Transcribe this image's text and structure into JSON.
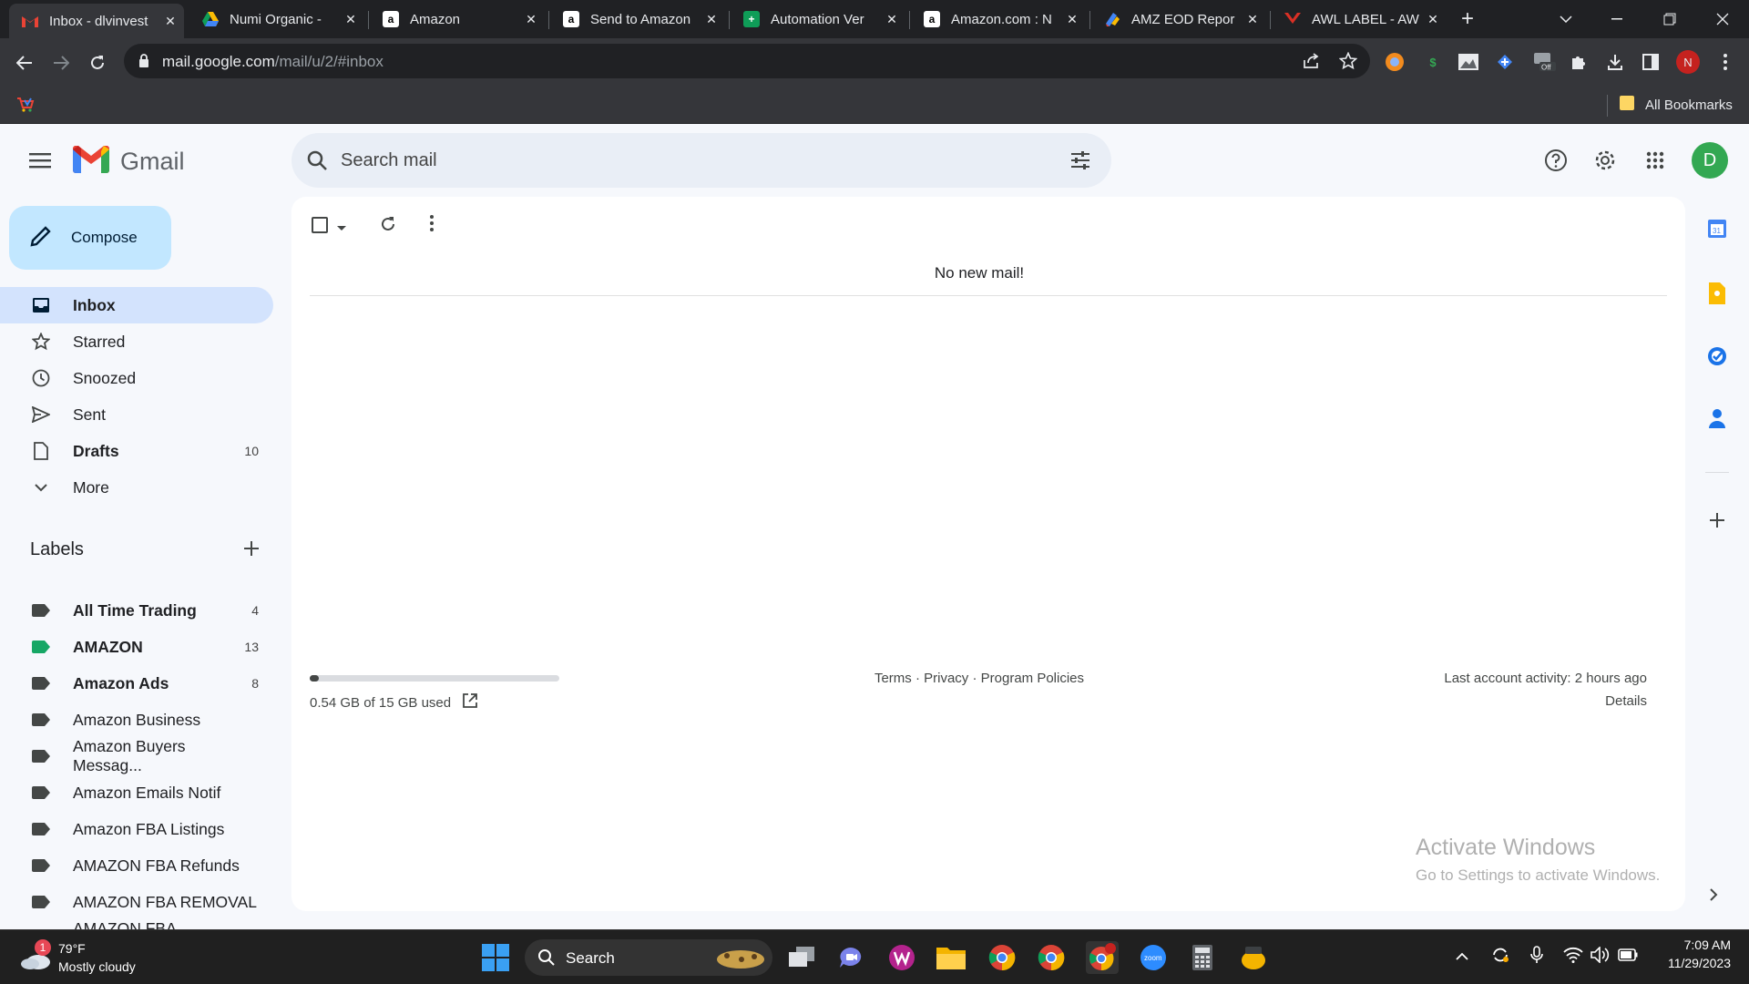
{
  "browser": {
    "tabs": [
      {
        "title": "Inbox - dlvinvest",
        "icon": "gmail-icon",
        "active": true
      },
      {
        "title": "Numi Organic - ",
        "icon": "google-drive-icon"
      },
      {
        "title": "Amazon",
        "icon": "amazon-icon"
      },
      {
        "title": "Send to Amazon",
        "icon": "amazon-icon"
      },
      {
        "title": "Automation Ver",
        "icon": "google-sheets-icon"
      },
      {
        "title": "Amazon.com : N",
        "icon": "amazon-icon"
      },
      {
        "title": "AMZ EOD Repor",
        "icon": "google-apps-script-icon"
      },
      {
        "title": "AWL LABEL - AW",
        "icon": "awl-label-icon"
      }
    ],
    "url_host": "mail.google.com",
    "url_path": "/mail/u/2/#inbox",
    "bookmarks_label": "All Bookmarks",
    "profile_initial": "N"
  },
  "gmail": {
    "brand": "Gmail",
    "search_placeholder": "Search mail",
    "avatar_initial": "D",
    "compose_label": "Compose",
    "nav": [
      {
        "label": "Inbox",
        "count": "",
        "icon": "inbox-icon"
      },
      {
        "label": "Starred",
        "count": "",
        "icon": "star-icon"
      },
      {
        "label": "Snoozed",
        "count": "",
        "icon": "clock-icon"
      },
      {
        "label": "Sent",
        "count": "",
        "icon": "send-icon"
      },
      {
        "label": "Drafts",
        "count": "10",
        "icon": "draft-icon"
      },
      {
        "label": "More",
        "count": "",
        "icon": "chevron-down-icon"
      }
    ],
    "labels_heading": "Labels",
    "labels": [
      {
        "label": "All Time Trading",
        "count": "4",
        "color": "#444746"
      },
      {
        "label": "AMAZON",
        "count": "13",
        "color": "#16a765"
      },
      {
        "label": "Amazon Ads",
        "count": "8",
        "color": "#444746"
      },
      {
        "label": "Amazon Business",
        "count": "",
        "color": "#444746"
      },
      {
        "label": "Amazon Buyers Messag...",
        "count": "",
        "color": "#444746"
      },
      {
        "label": "Amazon Emails Notif",
        "count": "",
        "color": "#444746"
      },
      {
        "label": "Amazon FBA Listings",
        "count": "",
        "color": "#444746"
      },
      {
        "label": "AMAZON FBA Refunds",
        "count": "",
        "color": "#444746"
      },
      {
        "label": "AMAZON FBA REMOVAL",
        "count": "",
        "color": "#444746"
      },
      {
        "label": "AMAZON FBA SHIPMEN...",
        "count": "",
        "color": "#444746"
      }
    ],
    "empty_message": "No new mail!",
    "storage_text": "0.54 GB of 15 GB used",
    "storage_fraction": 0.036,
    "footer_links": "Terms · Privacy · Program Policies",
    "last_activity": "Last account activity: 2 hours ago",
    "details_link": "Details",
    "watermark_title": "Activate Windows",
    "watermark_sub": "Go to Settings to activate Windows."
  },
  "taskbar": {
    "weather_temp": "79°F",
    "weather_desc": "Mostly cloudy",
    "weather_badge": "1",
    "search_label": "Search",
    "time": "7:09 AM",
    "date": "11/29/2023"
  }
}
